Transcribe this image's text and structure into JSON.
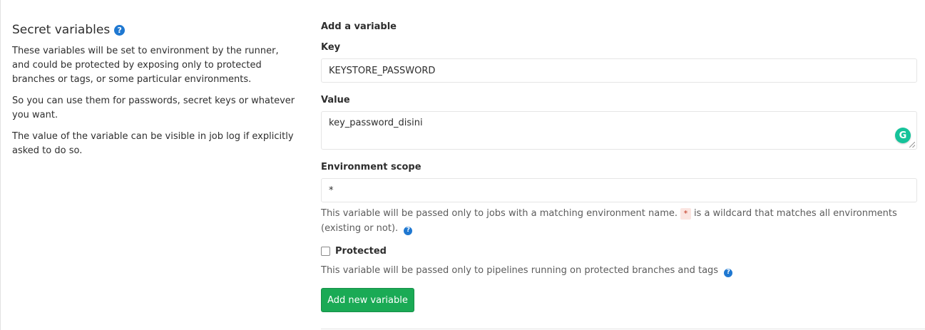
{
  "section": {
    "title": "Secret variables",
    "help_icon": "question-circle-icon",
    "paragraphs": [
      "These variables will be set to environment by the runner, and could be protected by exposing only to protected branches or tags, or some particular environments.",
      "So you can use them for passwords, secret keys or whatever you want.",
      "The value of the variable can be visible in job log if explicitly asked to do so."
    ]
  },
  "form": {
    "heading": "Add a variable",
    "key": {
      "label": "Key",
      "value": "KEYSTORE_PASSWORD"
    },
    "value": {
      "label": "Value",
      "value": "key_password_disini",
      "grammarly_icon": "G"
    },
    "environment_scope": {
      "label": "Environment scope",
      "value": "*",
      "help_before": "This variable will be passed only to jobs with a matching environment name.",
      "wildcard": "*",
      "help_after": "is a wildcard that matches all environments (existing or not)."
    },
    "protected": {
      "label": "Protected",
      "checked": false,
      "help": "This variable will be passed only to pipelines running on protected branches and tags"
    },
    "submit_label": "Add new variable"
  },
  "colors": {
    "primary_green": "#1aaa55",
    "help_blue": "#1f78d1",
    "grammarly_green": "#15c39a",
    "code_red": "#c0341d"
  }
}
